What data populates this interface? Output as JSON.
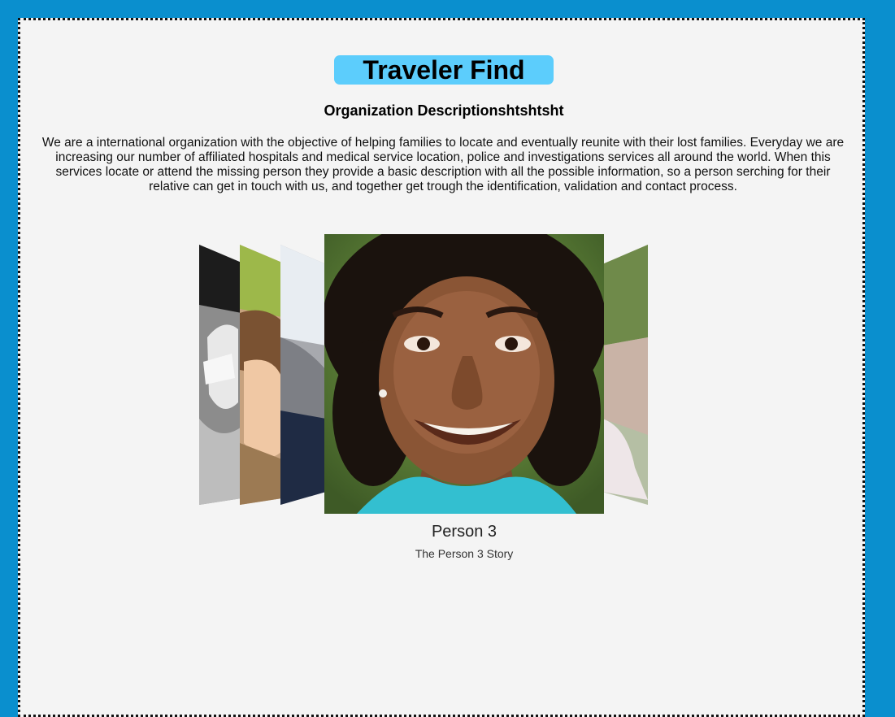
{
  "header": {
    "title": "Traveler Find",
    "subtitle": "Organization Descriptionshtshtsht",
    "description": "We are a international organization with the objective of helping families to locate and eventually reunite with their lost families. Everyday we are increasing our number of affiliated hospitals and medical service location, police and investigations services all around the world. When this services locate or attend the missing person they provide a basic description with all the possible information, so a person serching for their relative can get in touch with us, and together get trough the identification, validation and contact process."
  },
  "carousel": {
    "active_index": 2,
    "active": {
      "name": "Person 3",
      "story": "The Person 3 Story"
    }
  },
  "colors": {
    "page_background": "#0a8fce",
    "panel_background": "#f4f4f4",
    "title_pill": "#5ccdfc"
  }
}
